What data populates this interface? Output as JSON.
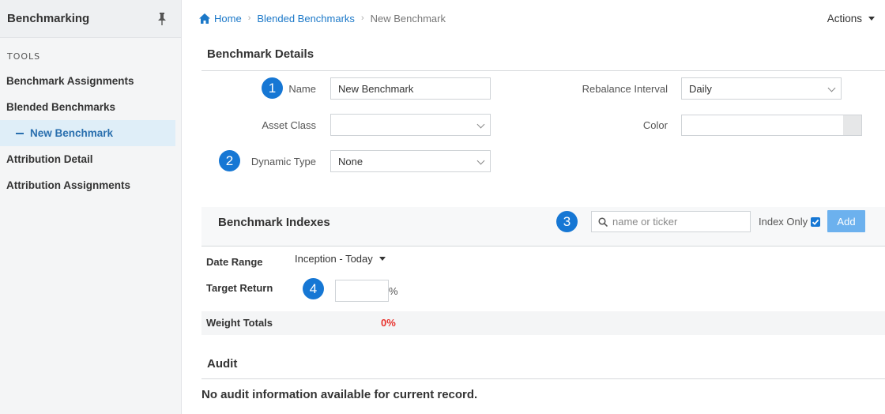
{
  "sidebar": {
    "title": "Benchmarking",
    "section": "TOOLS",
    "items": [
      {
        "label": "Benchmark Assignments"
      },
      {
        "label": "Blended Benchmarks"
      },
      {
        "label": "New Benchmark"
      },
      {
        "label": "Attribution Detail"
      },
      {
        "label": "Attribution Assignments"
      }
    ]
  },
  "breadcrumb": {
    "home": "Home",
    "parent": "Blended Benchmarks",
    "current": "New Benchmark"
  },
  "actions_label": "Actions",
  "details": {
    "title": "Benchmark Details",
    "name_label": "Name",
    "name_value": "New Benchmark",
    "asset_class_label": "Asset Class",
    "asset_class_value": "",
    "dynamic_type_label": "Dynamic Type",
    "dynamic_type_value": "None",
    "rebalance_label": "Rebalance Interval",
    "rebalance_value": "Daily",
    "color_label": "Color",
    "color_value": ""
  },
  "indexes": {
    "title": "Benchmark Indexes",
    "search_placeholder": "name or ticker",
    "index_only_label": "Index Only",
    "index_only_checked": true,
    "add_label": "Add",
    "date_range_label": "Date Range",
    "date_range_value": "Inception - Today",
    "target_return_label": "Target Return",
    "target_return_value": "",
    "percent_symbol": "%",
    "weight_totals_label": "Weight Totals",
    "weight_totals_value": "0%"
  },
  "audit": {
    "title": "Audit",
    "message": "No audit information available for current record."
  },
  "badges": [
    "1",
    "2",
    "3",
    "4"
  ],
  "colors": {
    "accent": "#1677d4",
    "link": "#1b78c8",
    "error": "#e8322d",
    "add_button": "#6cb1ee"
  }
}
